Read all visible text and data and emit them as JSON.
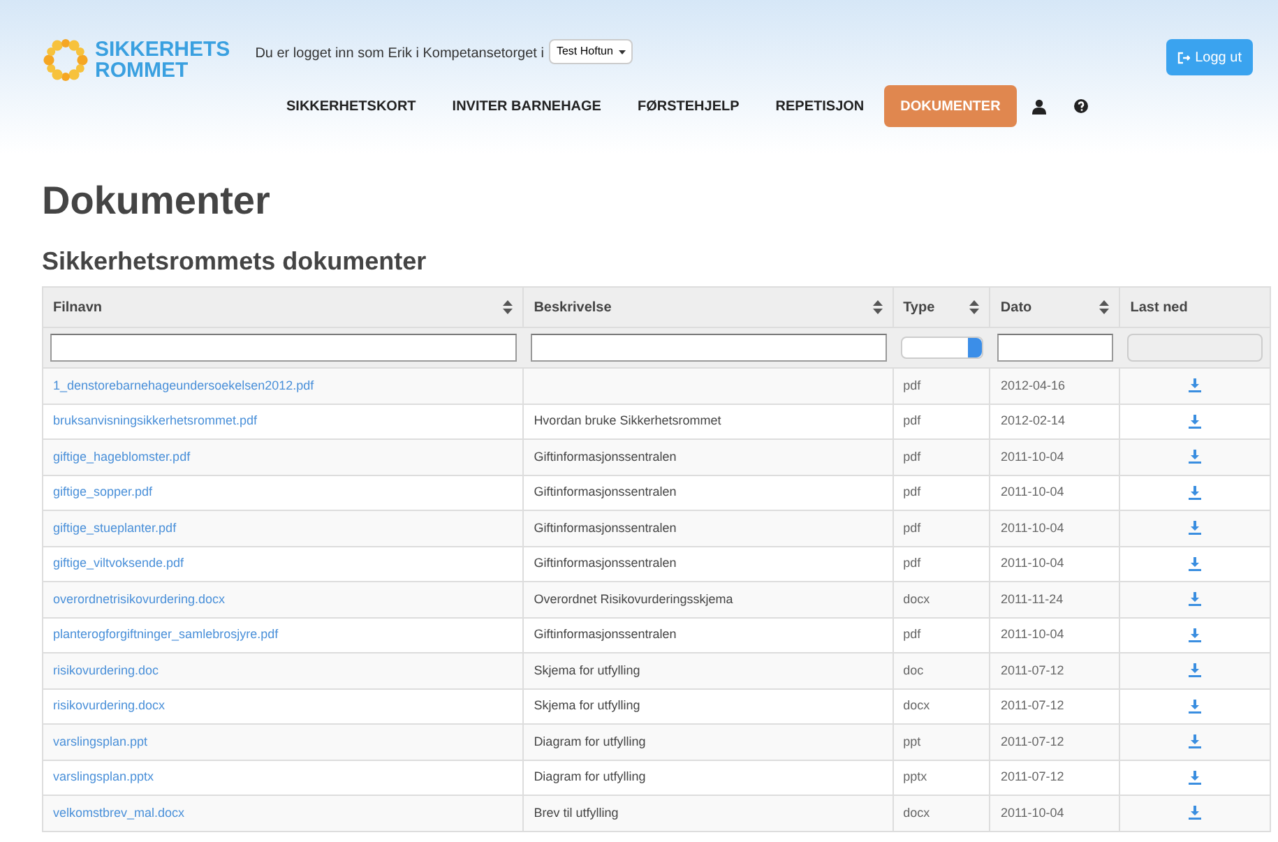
{
  "header": {
    "logo": {
      "line_1": "SIKKERHETS",
      "line_2": "ROMMET"
    },
    "login_text": "Du er logget inn som Erik i Kompetansetorget i",
    "org_select": "Test Hoftun",
    "logout_button": "Logg ut"
  },
  "nav": [
    {
      "kind": "text",
      "label": "SIKKERHETSKORT",
      "selected": false
    },
    {
      "kind": "text",
      "label": "INVITER BARNEHAGE",
      "selected": false
    },
    {
      "kind": "text",
      "label": "FØRSTEHJELP",
      "selected": false
    },
    {
      "kind": "text",
      "label": "REPETISJON",
      "selected": false
    },
    {
      "kind": "text",
      "label": "DOKUMENTER",
      "selected": true
    },
    {
      "kind": "user",
      "selected": false
    },
    {
      "kind": "help",
      "selected": false
    }
  ],
  "page_title": "Dokumenter",
  "section_title": "Sikkerhetsrommets dokumenter",
  "table": {
    "columns": [
      {
        "label": "Filnavn",
        "sortable": true
      },
      {
        "label": "Beskrivelse",
        "sortable": true
      },
      {
        "label": "Type",
        "sortable": true
      },
      {
        "label": "Dato",
        "sortable": true
      },
      {
        "label": "Last ned",
        "sortable": false
      }
    ],
    "filters": [
      {
        "kind": "text"
      },
      {
        "kind": "text"
      },
      {
        "kind": "select"
      },
      {
        "kind": "text"
      },
      {
        "kind": "disabled"
      }
    ],
    "rows": [
      {
        "file": "1_denstorebarnehageundersoekelsen2012.pdf",
        "description": "",
        "type": "pdf",
        "date": "2012-04-16"
      },
      {
        "file": "bruksanvisningsikkerhetsrommet.pdf",
        "description": "Hvordan bruke Sikkerhetsrommet",
        "type": "pdf",
        "date": "2012-02-14"
      },
      {
        "file": "giftige_hageblomster.pdf",
        "description": "Giftinformasjonssentralen",
        "type": "pdf",
        "date": "2011-10-04"
      },
      {
        "file": "giftige_sopper.pdf",
        "description": "Giftinformasjonssentralen",
        "type": "pdf",
        "date": "2011-10-04"
      },
      {
        "file": "giftige_stueplanter.pdf",
        "description": "Giftinformasjonssentralen",
        "type": "pdf",
        "date": "2011-10-04"
      },
      {
        "file": "giftige_viltvoksende.pdf",
        "description": "Giftinformasjonssentralen",
        "type": "pdf",
        "date": "2011-10-04"
      },
      {
        "file": "overordnetrisikovurdering.docx",
        "description": "Overordnet Risikovurderingsskjema",
        "type": "docx",
        "date": "2011-11-24"
      },
      {
        "file": "planterogforgiftninger_samlebrosjyre.pdf",
        "description": "Giftinformasjonssentralen",
        "type": "pdf",
        "date": "2011-10-04"
      },
      {
        "file": "risikovurdering.doc",
        "description": "Skjema for utfylling",
        "type": "doc",
        "date": "2011-07-12"
      },
      {
        "file": "risikovurdering.docx",
        "description": "Skjema for utfylling",
        "type": "docx",
        "date": "2011-07-12"
      },
      {
        "file": "varslingsplan.ppt",
        "description": "Diagram for utfylling",
        "type": "ppt",
        "date": "2011-07-12"
      },
      {
        "file": "varslingsplan.pptx",
        "description": "Diagram for utfylling",
        "type": "pptx",
        "date": "2011-07-12"
      },
      {
        "file": "velkomstbrev_mal.docx",
        "description": "Brev til utfylling",
        "type": "docx",
        "date": "2011-10-04"
      }
    ]
  }
}
